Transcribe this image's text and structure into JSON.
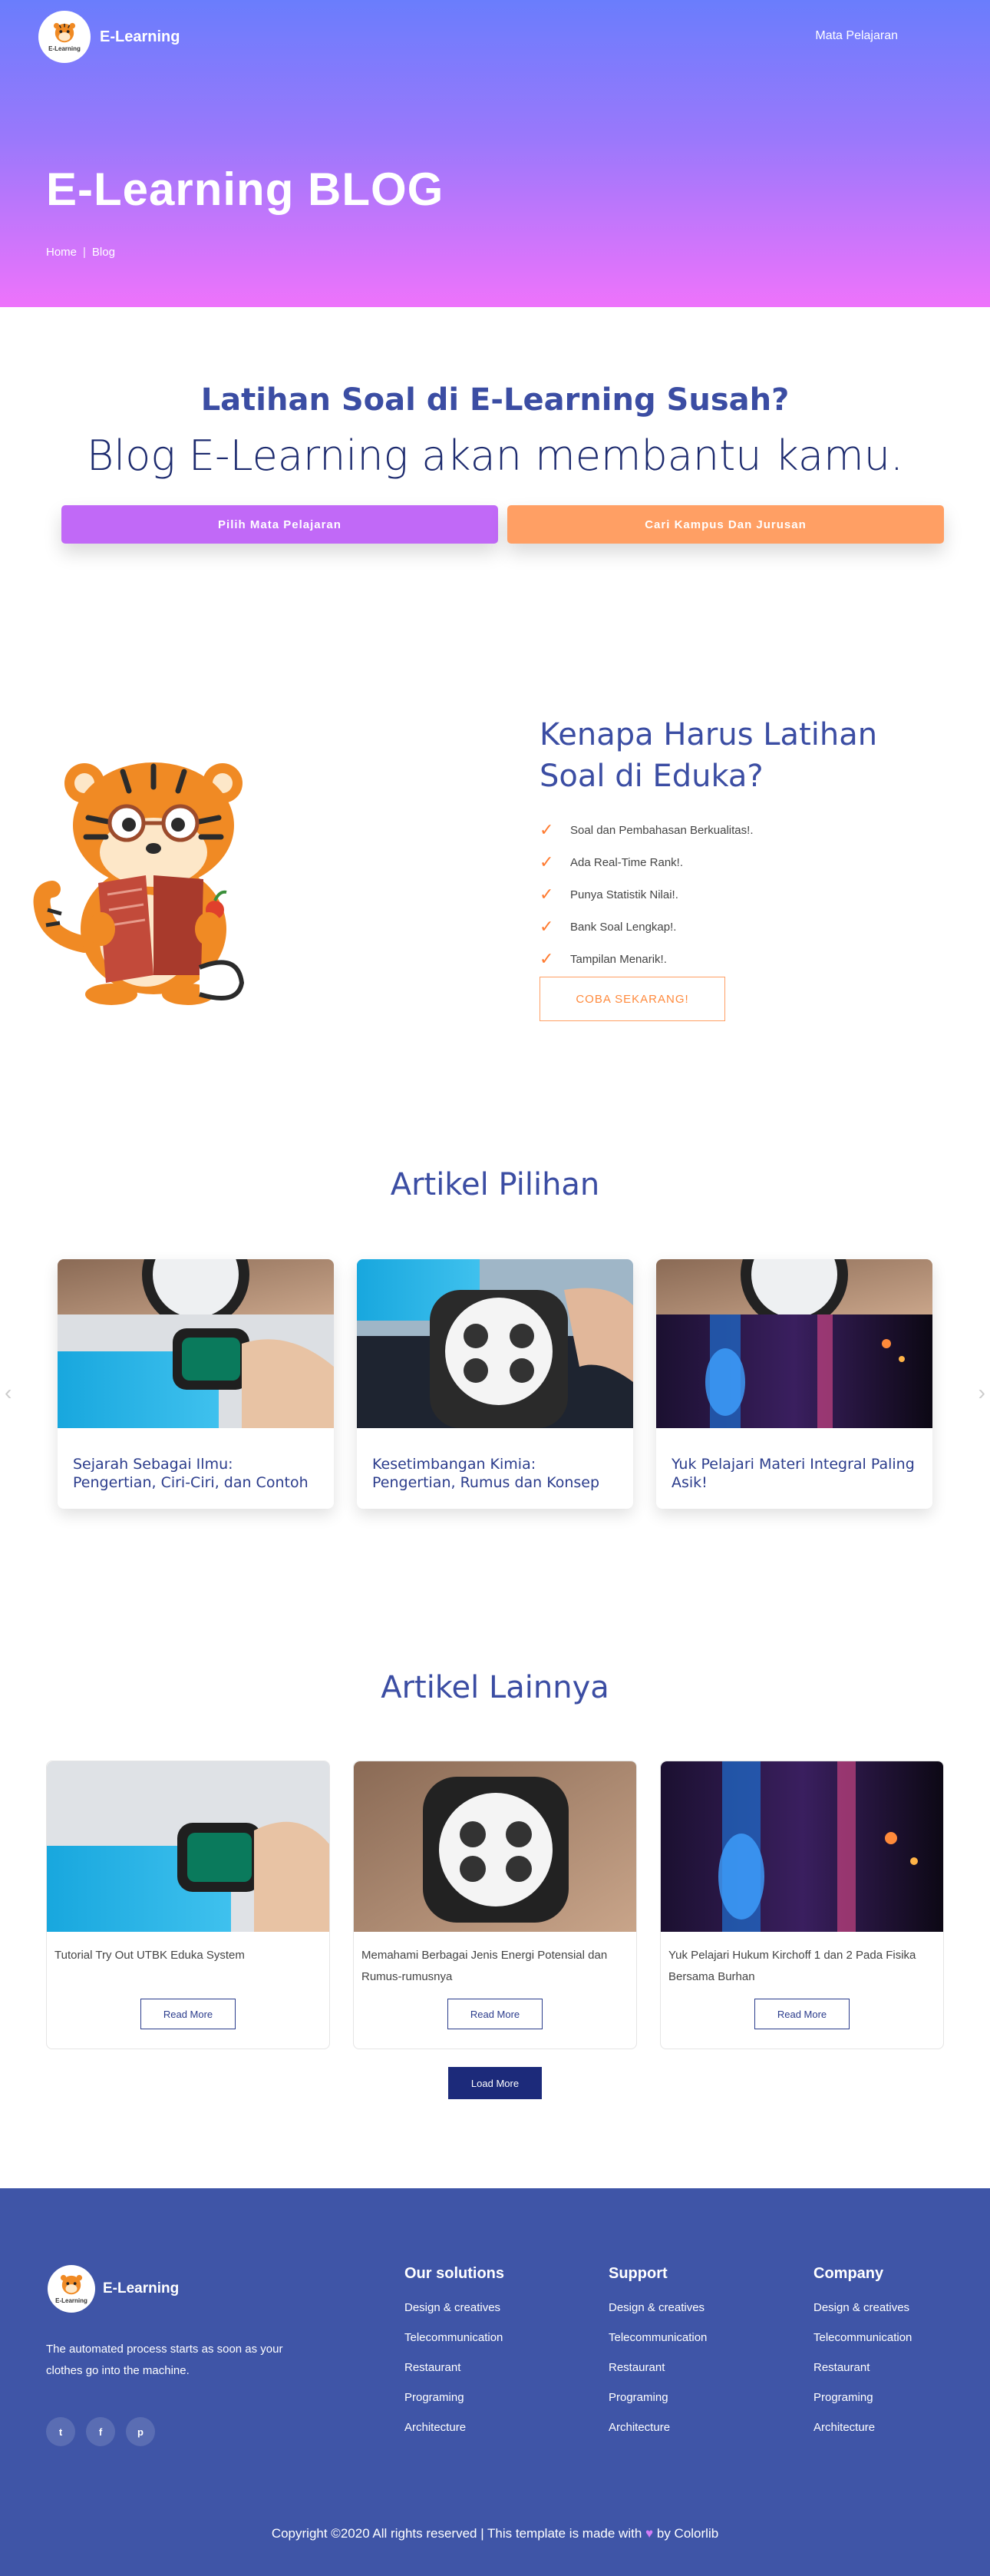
{
  "nav": {
    "brand": "E-Learning",
    "logo_text": "E-Learning",
    "link": "Mata Pelajaran"
  },
  "hero": {
    "title": "E-Learning BLOG",
    "breadcrumb": [
      "Home",
      "|",
      "Blog"
    ]
  },
  "intro": {
    "subtitle": "Latihan Soal di E-Learning Susah?",
    "title": "Blog E-Learning akan membantu kamu.",
    "buttons": [
      "Pilih Mata Pelajaran",
      "Cari Kampus Dan Jurusan"
    ]
  },
  "why": {
    "title": "Kenapa Harus Latihan Soal di Eduka?",
    "items": [
      "Soal dan Pembahasan Berkualitas!.",
      "Ada Real-Time Rank!.",
      "Punya Statistik Nilai!.",
      "Bank Soal Lengkap!.",
      "Tampilan Menarik!."
    ],
    "cta": "COBA SEKARANG!"
  },
  "pilihan": {
    "title": "Artikel Pilihan",
    "cards": [
      "Sejarah Sebagai Ilmu: Pengertian, Ciri-Ciri, dan Contoh",
      "Kesetimbangan Kimia: Pengertian, Rumus dan Konsep",
      "Yuk Pelajari Materi Integral Paling Asik!"
    ],
    "arrow_left": "‹",
    "arrow_right": "›"
  },
  "lainnya": {
    "title": "Artikel Lainnya",
    "cards": [
      {
        "text": "Tutorial Try Out UTBK Eduka System",
        "button": "Read More"
      },
      {
        "text": "Memahami Berbagai Jenis Energi Potensial dan Rumus-rumusnya",
        "button": "Read More"
      },
      {
        "text": "Yuk Pelajari Hukum Kirchoff 1 dan 2 Pada Fisika Bersama Burhan",
        "button": "Read More"
      }
    ],
    "load_more": "Load More"
  },
  "footer": {
    "brand": "E-Learning",
    "logo_text": "E-Learning",
    "description": "The automated process starts as soon as your clothes go into the machine.",
    "socials": [
      "t",
      "f",
      "p"
    ],
    "columns": [
      {
        "title": "Our solutions",
        "items": [
          "Design & creatives",
          "Telecommunication",
          "Restaurant",
          "Programing",
          "Architecture"
        ]
      },
      {
        "title": "Support",
        "items": [
          "Design & creatives",
          "Telecommunication",
          "Restaurant",
          "Programing",
          "Architecture"
        ]
      },
      {
        "title": "Company",
        "items": [
          "Design & creatives",
          "Telecommunication",
          "Restaurant",
          "Programing",
          "Architecture"
        ]
      }
    ],
    "copyright_pre": "Copyright ©2020 All rights reserved | This template is made with",
    "heart": "♥",
    "copyright_post": "by Colorlib"
  }
}
